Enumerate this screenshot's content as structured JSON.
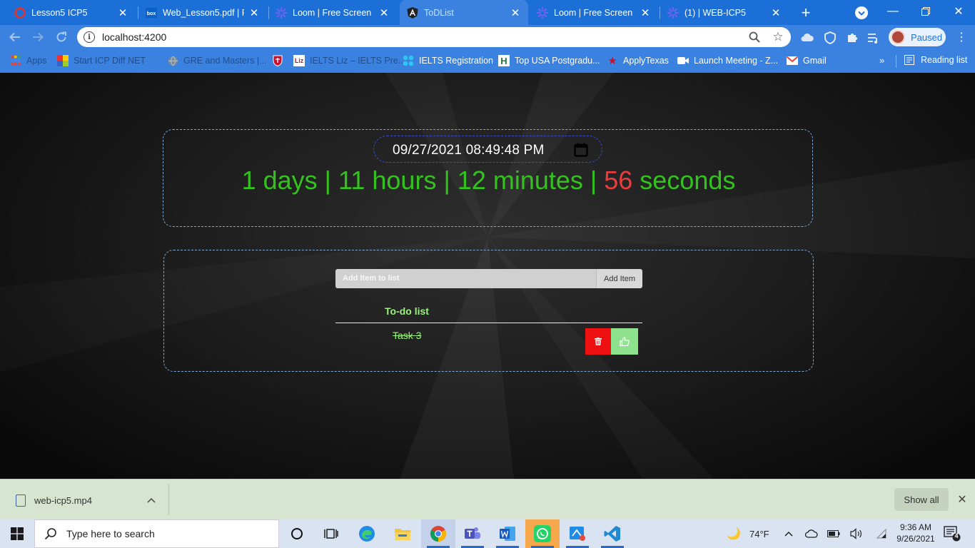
{
  "browser": {
    "tabs": [
      {
        "title": "Lesson5 ICP5",
        "icon": "opera-icon"
      },
      {
        "title": "Web_Lesson5.pdf | Po",
        "icon": "box-icon"
      },
      {
        "title": "Loom | Free Screen &",
        "icon": "loom-icon"
      },
      {
        "title": "ToDList",
        "icon": "angular-icon"
      },
      {
        "title": "Loom | Free Screen &",
        "icon": "loom-icon"
      },
      {
        "title": "(1) | WEB-ICP5",
        "icon": "loom-icon"
      }
    ],
    "active_tab": 3,
    "address": "localhost:4200",
    "profile_label": "Paused",
    "bookmarks": [
      {
        "label": "Apps",
        "icon": "apps-grid-icon"
      },
      {
        "label": "Start ICP Diff NET",
        "icon": "colored-grid-icon"
      },
      {
        "label": "GRE and Masters |...",
        "icon": "globe-icon"
      },
      {
        "label": "",
        "icon": "shield-crest-icon"
      },
      {
        "label": "IELTS Liz – IELTS Pre...",
        "icon": "liz-icon"
      },
      {
        "label": "IELTS Registration",
        "icon": "ielts-icon"
      },
      {
        "label": "Top USA Postgradu...",
        "icon": "h-icon"
      },
      {
        "label": "ApplyTexas",
        "icon": "star-icon"
      },
      {
        "label": "Launch Meeting - Z...",
        "icon": "zoom-icon"
      },
      {
        "label": "Gmail",
        "icon": "gmail-icon"
      }
    ],
    "reading_list": "Reading list"
  },
  "app": {
    "datetime_value": "09/27/2021 08:49:48 PM",
    "countdown": {
      "days": "1 days | ",
      "hours": "11 hours | ",
      "minutes": "12 minutes | ",
      "seconds_value": "56",
      "seconds_label": " seconds"
    },
    "add_placeholder": "Add Item to list",
    "add_button": "Add Item",
    "list_title": "To-do list",
    "tasks": [
      {
        "name": "Task 3",
        "done": true
      }
    ],
    "colors": {
      "countdown": "#34c21e",
      "seconds": "#ee3c3c",
      "delete": "#ee1111",
      "complete": "#8fe28d",
      "list_text": "#9df27f"
    }
  },
  "downloads": {
    "file_name": "web-icp5.mp4",
    "show_all": "Show all"
  },
  "taskbar": {
    "search_placeholder": "Type here to search",
    "weather": "74°F",
    "time": "9:36 AM",
    "date": "9/26/2021",
    "notification_count": "4"
  }
}
